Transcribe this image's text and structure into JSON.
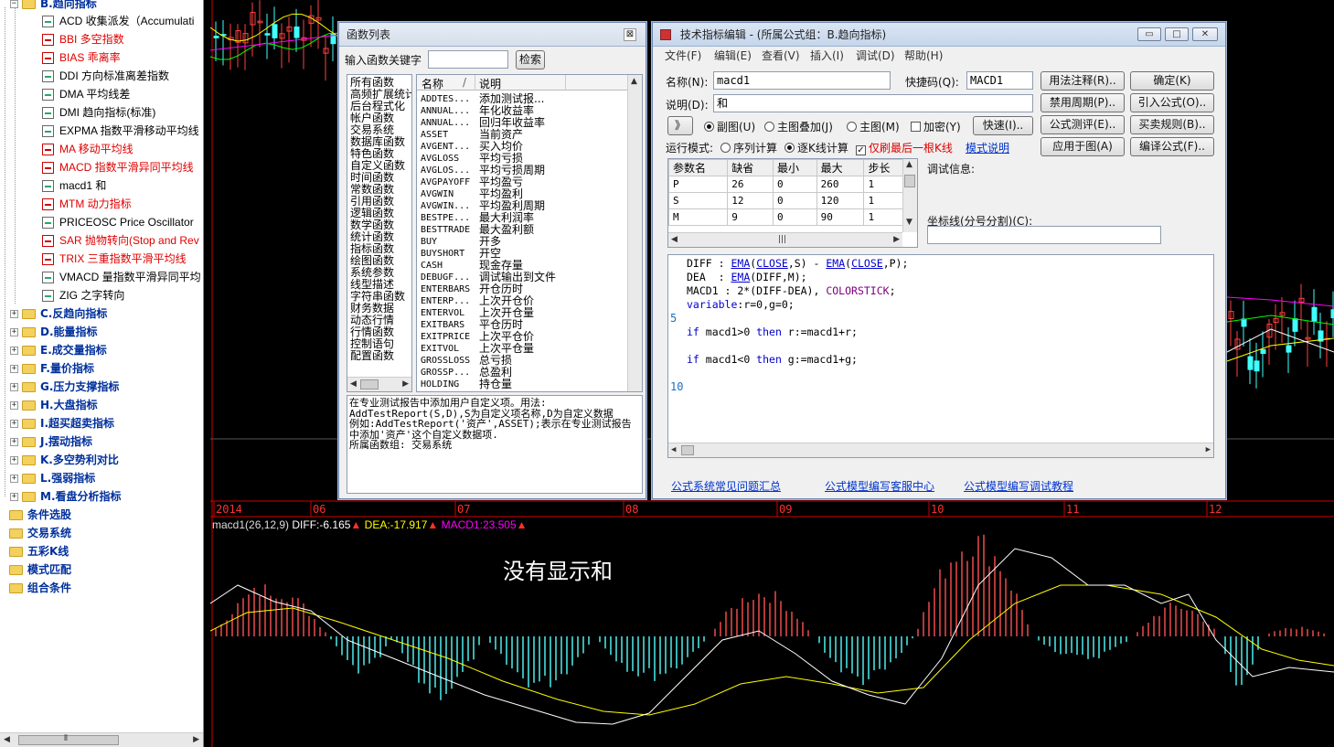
{
  "tree": {
    "group_b": "B.趋向指标",
    "items": [
      {
        "label": "ACD 收集派发（Accumulati",
        "color": "black",
        "icon": "formula-icon"
      },
      {
        "label": "BBI 多空指数",
        "color": "red",
        "icon": "formula-icon"
      },
      {
        "label": "BIAS 乖离率",
        "color": "red",
        "icon": "formula-icon"
      },
      {
        "label": "DDI 方向标准离差指数",
        "color": "black",
        "icon": "formula-icon"
      },
      {
        "label": "DMA 平均线差",
        "color": "black",
        "icon": "formula-icon"
      },
      {
        "label": "DMI 趋向指标(标准)",
        "color": "black",
        "icon": "formula-icon"
      },
      {
        "label": "EXPMA 指数平滑移动平均线",
        "color": "black",
        "icon": "formula-icon"
      },
      {
        "label": "MA 移动平均线",
        "color": "red",
        "icon": "formula-icon"
      },
      {
        "label": "MACD 指数平滑异同平均线",
        "color": "red",
        "icon": "formula-icon"
      },
      {
        "label": "macd1 和",
        "color": "black",
        "icon": "formula-icon"
      },
      {
        "label": "MTM 动力指标",
        "color": "red",
        "icon": "formula-icon"
      },
      {
        "label": "PRICEOSC Price Oscillator",
        "color": "black",
        "icon": "formula-icon"
      },
      {
        "label": "SAR 抛物转向(Stop and Rev",
        "color": "red",
        "icon": "formula-icon"
      },
      {
        "label": "TRIX 三重指数平滑平均线",
        "color": "red",
        "icon": "formula-icon"
      },
      {
        "label": "VMACD 量指数平滑异同平均",
        "color": "black",
        "icon": "formula-icon"
      },
      {
        "label": "ZIG 之字转向",
        "color": "black",
        "icon": "formula-icon"
      }
    ],
    "categories": [
      "C.反趋向指标",
      "D.能量指标",
      "E.成交量指标",
      "F.量价指标",
      "G.压力支撑指标",
      "H.大盘指标",
      "I.超买超卖指标",
      "J.摆动指标",
      "K.多空势利对比",
      "L.强弱指标",
      "M.看盘分析指标"
    ],
    "roots": [
      "条件选股",
      "交易系统",
      "五彩K线",
      "模式匹配",
      "组合条件"
    ],
    "scroll_glyph": "⦀"
  },
  "chart": {
    "date_labels": [
      "2014",
      "06",
      "07",
      "08",
      "09",
      "10",
      "11",
      "12"
    ],
    "indicator_name": "macd1(26,12,9)",
    "diff_text": "DIFF:-6.165",
    "dea_text": "DEA:-17.917",
    "macd_text": "MACD1:23.505",
    "annotation": "没有显示和",
    "colors": {
      "diff": "#ffffff",
      "dea": "#ffff00",
      "macd": "#ff00ff",
      "up_bar": "#ff5050",
      "down_bar": "#54ffff",
      "axis": "#d00000"
    }
  },
  "func_window": {
    "title": "函数列表",
    "search_label": "输入函数关键字",
    "search_value": "",
    "search_button": "检索",
    "categories": [
      "所有函数",
      "高频扩展统计",
      "后台程式化",
      "帐户函数",
      "交易系统",
      "数据库函数",
      "特色函数",
      "自定义函数",
      "时间函数",
      "常数函数",
      "引用函数",
      "逻辑函数",
      "数学函数",
      "统计函数",
      "指标函数",
      "绘图函数",
      "系统参数",
      "线型描述",
      "字符串函数",
      "财务数据",
      "动态行情",
      "行情函数",
      "控制语句",
      "配置函数"
    ],
    "col_name": "名称",
    "col_desc": "说明",
    "functions": [
      {
        "name": "ADDTES...",
        "desc": "添加测试报..."
      },
      {
        "name": "ANNUAL...",
        "desc": "年化收益率"
      },
      {
        "name": "ANNUAL...",
        "desc": "回归年收益率"
      },
      {
        "name": "ASSET",
        "desc": "当前资产"
      },
      {
        "name": "AVGENT...",
        "desc": "买入均价"
      },
      {
        "name": "AVGLOSS",
        "desc": "平均亏损"
      },
      {
        "name": "AVGLOS...",
        "desc": "平均亏损周期"
      },
      {
        "name": "AVGPAYOFF",
        "desc": "平均盈亏"
      },
      {
        "name": "AVGWIN",
        "desc": "平均盈利"
      },
      {
        "name": "AVGWIN...",
        "desc": "平均盈利周期"
      },
      {
        "name": "BESTPE...",
        "desc": "最大利润率"
      },
      {
        "name": "BESTTRADE",
        "desc": "最大盈利额"
      },
      {
        "name": "BUY",
        "desc": "开多"
      },
      {
        "name": "BUYSHORT",
        "desc": "开空"
      },
      {
        "name": "CASH",
        "desc": "现金存量"
      },
      {
        "name": "DEBUGF...",
        "desc": "调试输出到文件"
      },
      {
        "name": "ENTERBARS",
        "desc": "开仓历时"
      },
      {
        "name": "ENTERP...",
        "desc": "上次开仓价"
      },
      {
        "name": "ENTERVOL",
        "desc": "上次开仓量"
      },
      {
        "name": "EXITBARS",
        "desc": "平仓历时"
      },
      {
        "name": "EXITPRICE",
        "desc": "上次平仓价"
      },
      {
        "name": "EXITVOL",
        "desc": "上次平仓量"
      },
      {
        "name": "GROSSLOSS",
        "desc": "总亏损"
      },
      {
        "name": "GROSSP...",
        "desc": "总盈利"
      },
      {
        "name": "HOLDING",
        "desc": "持仓量"
      }
    ],
    "help_lines": [
      "在专业测试报告中添加用户自定义项。用法:",
      "AddTestReport(S,D),S为自定义项名称,D为自定义数据",
      "例如:AddTestReport('资产',ASSET);表示在专业测试报告",
      "中添加'资产'这个自定义数据项.",
      "所属函数组: 交易系统"
    ]
  },
  "editor": {
    "title": "技术指标编辑 - (所属公式组：B.趋向指标)",
    "menu": [
      "文件(F)",
      "编辑(E)",
      "查看(V)",
      "插入(I)",
      "调试(D)",
      "帮助(H)"
    ],
    "name_label": "名称(N):",
    "name_value": "macd1",
    "hotkey_label": "快捷码(Q):",
    "hotkey_value": "MACD1",
    "desc_label": "说明(D):",
    "desc_value": "和",
    "expand_btn": "》",
    "radio_sub": "副图(U)",
    "radio_overlay": "主图叠加(J)",
    "radio_main": "主图(M)",
    "check_encrypt": "加密(Y)",
    "fast_btn": "快速(I)..",
    "run_mode_label": "运行模式:",
    "radio_seq": "序列计算",
    "radio_tick": "逐K线计算",
    "check_last": "仅刷最后一根K线",
    "mode_link": "模式说明",
    "buttons": [
      "用法注释(R)..",
      "确定(K)",
      "禁用周期(P)..",
      "引入公式(O)..",
      "公式测评(E)..",
      "买卖规则(B)..",
      "应用于图(A)",
      "编译公式(F).."
    ],
    "param_headers": [
      "参数名",
      "缺省",
      "最小",
      "最大",
      "步长"
    ],
    "params": [
      [
        "P",
        "26",
        "0",
        "260",
        "1"
      ],
      [
        "S",
        "12",
        "0",
        "120",
        "1"
      ],
      [
        "M",
        "9",
        "0",
        "90",
        "1"
      ]
    ],
    "debug_label": "调试信息:",
    "coord_label": "坐标线(分号分割)(C):",
    "coord_value": "",
    "line_numbers": [
      "5",
      "10"
    ],
    "links": [
      "公式系统常见问题汇总",
      "公式模型编写客服中心",
      "公式模型编写调试教程"
    ]
  }
}
